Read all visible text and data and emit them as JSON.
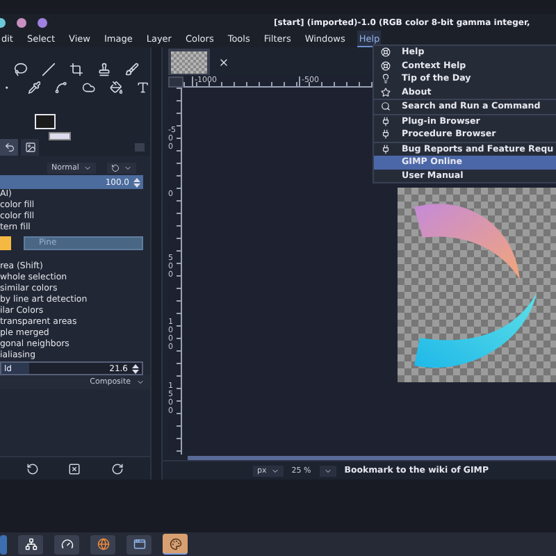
{
  "window": {
    "title": "[start] (imported)-1.0 (RGB color 8-bit gamma integer,",
    "dots": [
      {
        "color": "#6cc8d8"
      },
      {
        "color": "#c890c0"
      },
      {
        "color": "#a080e0"
      }
    ]
  },
  "menubar": [
    {
      "label": "dit",
      "selected": false
    },
    {
      "label": "Select",
      "selected": false
    },
    {
      "label": "View",
      "selected": false
    },
    {
      "label": "Image",
      "selected": false
    },
    {
      "label": "Layer",
      "selected": false
    },
    {
      "label": "Colors",
      "selected": false
    },
    {
      "label": "Tools",
      "selected": false
    },
    {
      "label": "Filters",
      "selected": false
    },
    {
      "label": "Windows",
      "selected": false
    },
    {
      "label": "Help",
      "selected": true
    }
  ],
  "dock_tabs": [
    {
      "selected": true
    },
    {
      "selected": false
    }
  ],
  "tool_options": {
    "mode": "Normal",
    "opacity": {
      "reading": "100.0",
      "level": 1
    },
    "fill_type": [
      "AI)",
      "color fill",
      "color fill",
      "tern fill"
    ],
    "pattern": {
      "name": "Pine",
      "color": "#f4b942"
    },
    "options": [
      "rea  (Shift)",
      "whole selection",
      "similar colors",
      "by line art detection",
      "ilar Colors",
      "transparent areas",
      "ple merged",
      "gonal neighbors",
      "ialiasing"
    ],
    "threshold": {
      "label": "ld",
      "reading": "21.6",
      "level": 0.2
    },
    "sample": "Composite"
  },
  "rulers": {
    "horizontal": [
      "-1000",
      "-500"
    ],
    "vertical": [
      "-500",
      "0",
      "500",
      "1000",
      "1500"
    ]
  },
  "status_bar": {
    "unit": "px",
    "zoom": "25 %",
    "message": "Bookmark to the wiki of GIMP"
  },
  "help_menu": [
    {
      "items": [
        {
          "label": "Help",
          "selected": false
        },
        {
          "label": "Context Help",
          "selected": false
        },
        {
          "label": "Tip of the Day",
          "selected": false
        },
        {
          "label": "About",
          "selected": false
        }
      ]
    },
    {
      "items": [
        {
          "label": "Search and Run a Command",
          "selected": false
        }
      ]
    },
    {
      "items": [
        {
          "label": "Plug-in Browser",
          "selected": false
        },
        {
          "label": "Procedure Browser",
          "selected": false
        }
      ]
    },
    {
      "items": [
        {
          "label": "Bug Reports and Feature Requ",
          "selected": false
        },
        {
          "label": "GIMP Online",
          "selected": true
        },
        {
          "label": "User Manual",
          "selected": false
        }
      ]
    }
  ]
}
